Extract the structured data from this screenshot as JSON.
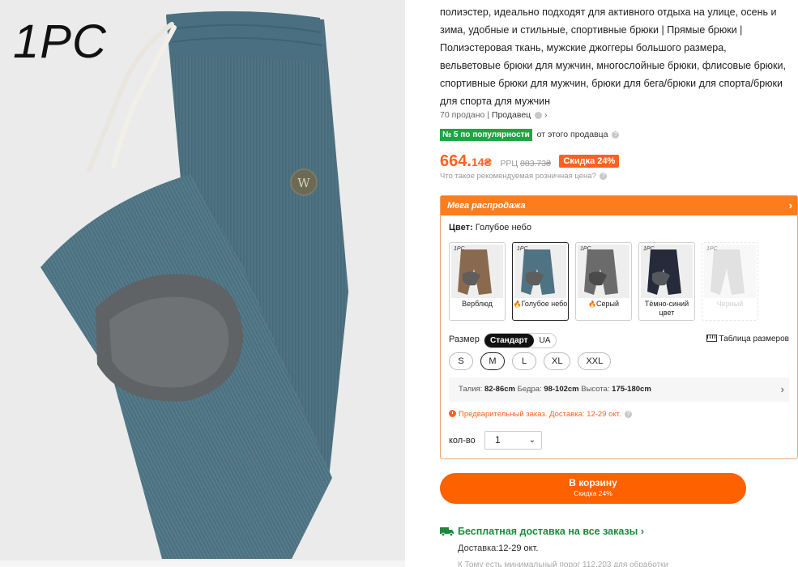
{
  "image": {
    "caption": "1PC",
    "logo_letter": "W"
  },
  "product": {
    "title": "полиэстер, идеально подходят для активного отдыха на улице, осень и зима, удобные и стильные, спортивные брюки | Прямые брюки | Полиэстеровая ткань, мужские джоггеры большого размера, вельветовые брюки для мужчин, многослойные брюки, флисовые брюки, спортивные брюки для мужчин, брюки для бега/брюки для спорта/брюки для спорта для мужчин",
    "sold": "70 продано",
    "separator": "|",
    "seller_label": "Продавец",
    "seller_chevron": "›",
    "rank_badge": "№ 5 по популярности",
    "rank_text": "от этого продавца"
  },
  "price": {
    "main": "664.",
    "cents": "14₴",
    "rrp_label": "РРЦ",
    "rrp_value": "883.73₴",
    "discount": "Скидка 24%",
    "rrp_question": "Что такое рекомендуемая розничная цена?"
  },
  "promo": {
    "banner": "Мега распродажа",
    "chevron": "›",
    "color_label": "Цвет:",
    "color_value": "Голубое небо",
    "swatches": [
      {
        "pc": "1PC",
        "name": "Верблюд",
        "hot": false
      },
      {
        "pc": "1PC",
        "name": "Голубое небо",
        "hot": true
      },
      {
        "pc": "1PC",
        "name": "Серый",
        "hot": true
      },
      {
        "pc": "1PC",
        "name": "Тёмно-синий цвет",
        "hot": false
      },
      {
        "pc": "1PC",
        "name": "Черный",
        "hot": false
      }
    ],
    "hot_glyph": "🔥",
    "size_label": "Размер",
    "size_system_active": "Стандарт",
    "size_system_other": "UA",
    "size_chart": "Таблица размеров",
    "sizes": [
      "S",
      "M",
      "L",
      "XL",
      "XXL"
    ],
    "selected_size": "M",
    "measure": {
      "waist_label": "Талия:",
      "waist": "82-86cm",
      "hips_label": "Бедра:",
      "hips": "98-102cm",
      "height_label": "Высота:",
      "height": "175-180cm",
      "chevron": "›"
    },
    "preorder": "Предварительный заказ. Доставка: 12-29 окт.",
    "qty_label": "кол-во",
    "qty_value": "1",
    "qty_caret": "⌄"
  },
  "cart": {
    "label": "В корзину",
    "sub": "Скидка 24%"
  },
  "shipping": {
    "free": "Бесплатная доставка на все заказы",
    "chevron": "›",
    "delivery_label": "Доставка:",
    "delivery_date": "12-29 окт.",
    "cutoff": "К Тому есть минимальный порог 112.203 для обработки"
  },
  "colors": {
    "accent": "#fd6120",
    "green": "#20a442",
    "pants_blue": "#4f7383"
  }
}
